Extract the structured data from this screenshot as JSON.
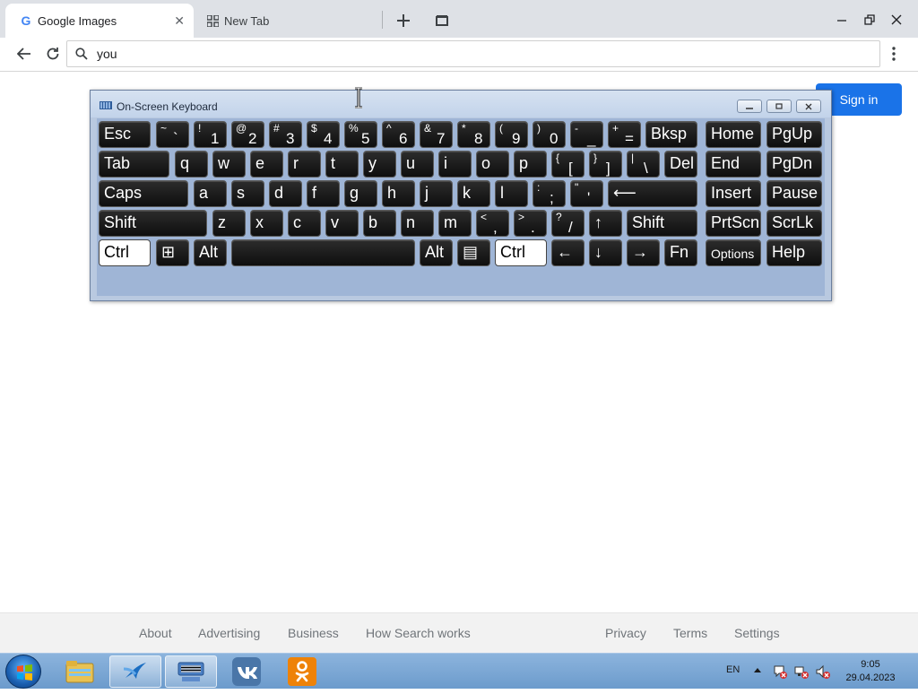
{
  "browser": {
    "tabs": [
      {
        "label": "Google Images",
        "icon": "google-g-icon",
        "active": true
      },
      {
        "label": "New Tab",
        "icon": "grid-icon",
        "active": false
      }
    ],
    "address_value": "you"
  },
  "page": {
    "signin_label": "Sign in",
    "accent_color": "#1a73e8",
    "footer_left": [
      "About",
      "Advertising",
      "Business",
      "How Search works"
    ],
    "footer_right": [
      "Privacy",
      "Terms",
      "Settings"
    ]
  },
  "osk": {
    "title": "On-Screen Keyboard",
    "row1": [
      {
        "label": "Esc"
      },
      {
        "shift": "~",
        "base": "`"
      },
      {
        "shift": "!",
        "base": "1"
      },
      {
        "shift": "@",
        "base": "2"
      },
      {
        "shift": "#",
        "base": "3"
      },
      {
        "shift": "$",
        "base": "4"
      },
      {
        "shift": "%",
        "base": "5"
      },
      {
        "shift": "^",
        "base": "6"
      },
      {
        "shift": "&",
        "base": "7"
      },
      {
        "shift": "*",
        "base": "8"
      },
      {
        "shift": "(",
        "base": "9"
      },
      {
        "shift": ")",
        "base": "0"
      },
      {
        "shift": "-",
        "base": "_"
      },
      {
        "shift": "+",
        "base": "="
      },
      {
        "label": "Bksp"
      },
      {
        "label": "Home"
      },
      {
        "label": "PgUp"
      }
    ],
    "row2": [
      {
        "label": "Tab"
      },
      {
        "label": "q"
      },
      {
        "label": "w"
      },
      {
        "label": "e"
      },
      {
        "label": "r"
      },
      {
        "label": "t"
      },
      {
        "label": "y"
      },
      {
        "label": "u"
      },
      {
        "label": "i"
      },
      {
        "label": "o"
      },
      {
        "label": "p"
      },
      {
        "shift": "{",
        "base": "["
      },
      {
        "shift": "}",
        "base": "]"
      },
      {
        "shift": "|",
        "base": "\\"
      },
      {
        "label": "Del"
      },
      {
        "label": "End"
      },
      {
        "label": "PgDn"
      }
    ],
    "row3": [
      {
        "label": "Caps"
      },
      {
        "label": "a"
      },
      {
        "label": "s"
      },
      {
        "label": "d"
      },
      {
        "label": "f"
      },
      {
        "label": "g"
      },
      {
        "label": "h"
      },
      {
        "label": "j"
      },
      {
        "label": "k"
      },
      {
        "label": "l"
      },
      {
        "shift": ":",
        "base": ";"
      },
      {
        "shift": "\"",
        "base": "'"
      },
      {
        "label": "⟵"
      },
      {
        "label": "Insert"
      },
      {
        "label": "Pause"
      }
    ],
    "row4": [
      {
        "label": "Shift"
      },
      {
        "label": "z"
      },
      {
        "label": "x"
      },
      {
        "label": "c"
      },
      {
        "label": "v"
      },
      {
        "label": "b"
      },
      {
        "label": "n"
      },
      {
        "label": "m"
      },
      {
        "shift": "<",
        "base": ","
      },
      {
        "shift": ">",
        "base": "."
      },
      {
        "shift": "?",
        "base": "/"
      },
      {
        "label": "↑"
      },
      {
        "label": "Shift"
      },
      {
        "label": "PrtScn"
      },
      {
        "label": "ScrLk"
      }
    ],
    "row5": [
      {
        "label": "Ctrl"
      },
      {
        "label": "⊞"
      },
      {
        "label": "Alt"
      },
      {
        "label": ""
      },
      {
        "label": "Alt"
      },
      {
        "label": "▤"
      },
      {
        "label": "Ctrl"
      },
      {
        "label": "←"
      },
      {
        "label": "↓"
      },
      {
        "label": "→"
      },
      {
        "label": "Fn"
      },
      {
        "label": "Options"
      },
      {
        "label": "Help"
      }
    ]
  },
  "taskbar": {
    "lang": "EN",
    "time": "9:05",
    "date": "29.04.2023"
  }
}
